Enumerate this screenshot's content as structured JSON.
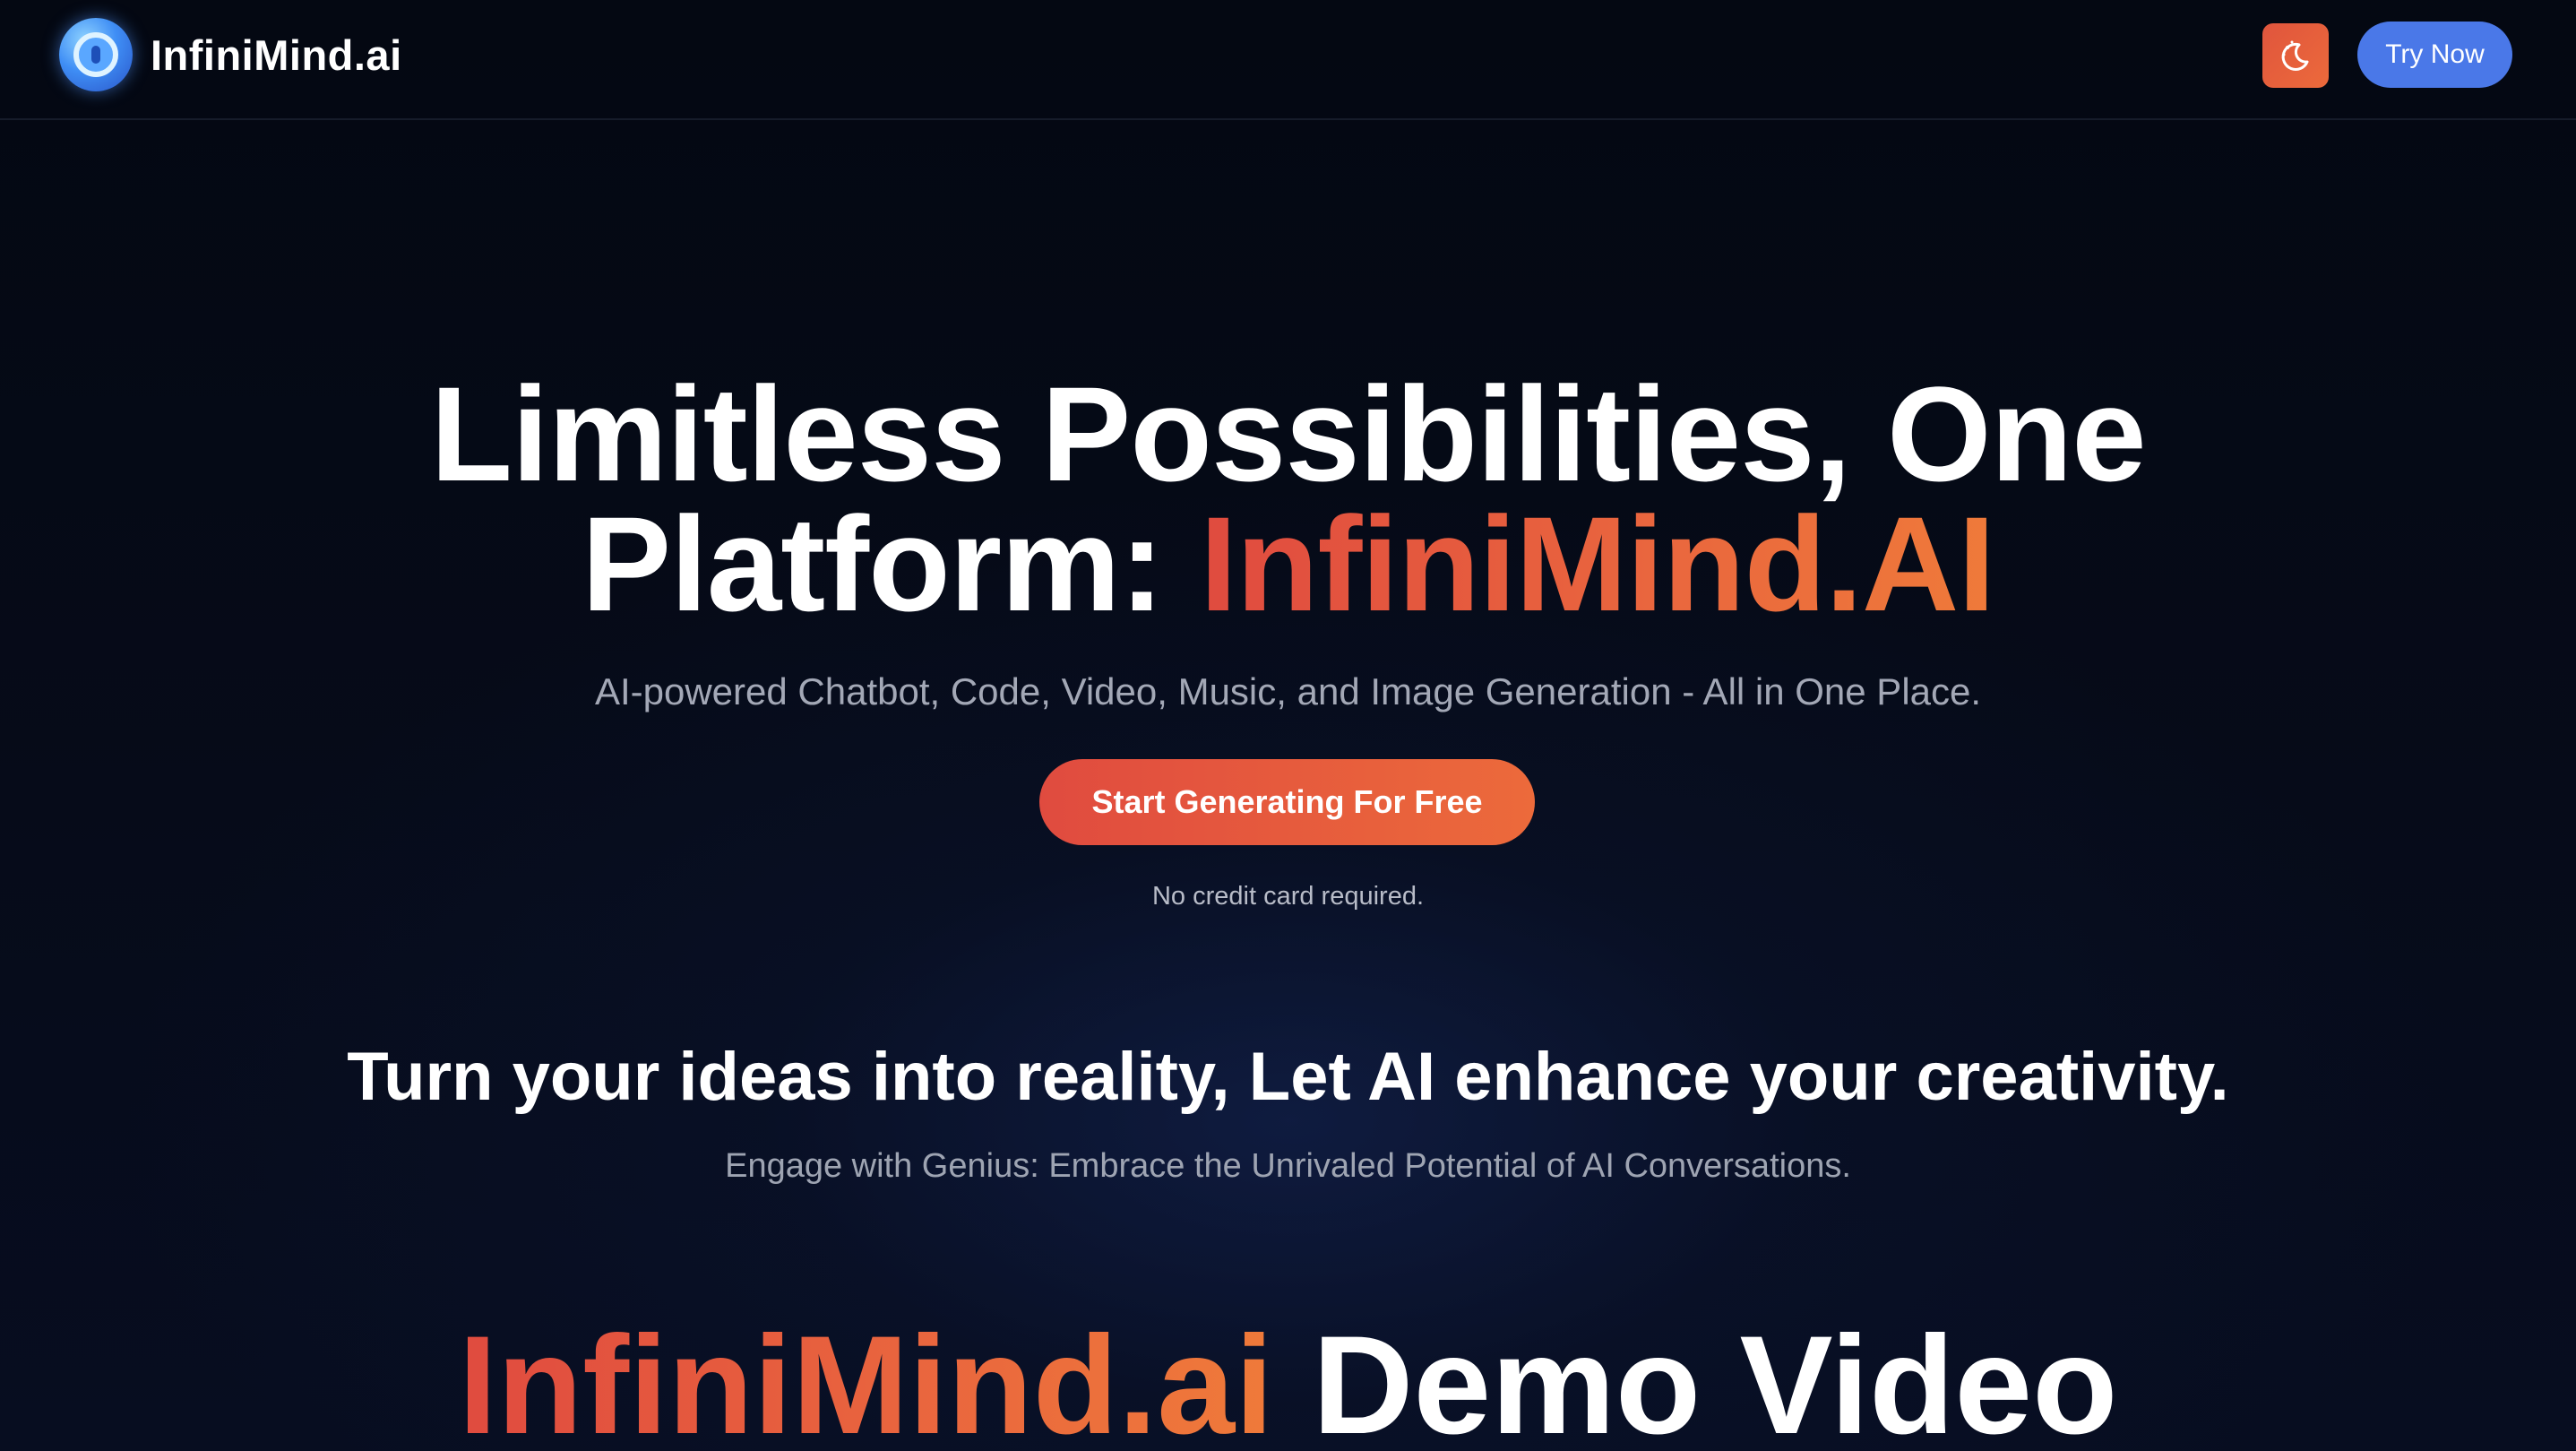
{
  "header": {
    "brand_name": "InfiniMind.ai",
    "try_now_label": "Try Now"
  },
  "hero": {
    "title_line1": "Limitless Possibilities, One",
    "title_line2_prefix": "Platform: ",
    "title_line2_highlight": "InfiniMind.AI",
    "subtitle": "AI-powered Chatbot, Code, Video, Music, and Image Generation - All in One Place.",
    "cta_label": "Start Generating For Free",
    "cta_note": "No credit card required."
  },
  "tagline": {
    "title": "Turn your ideas into reality, Let AI enhance your creativity.",
    "subtitle": "Engage with Genius: Embrace the Unrivaled Potential of AI Conversations."
  },
  "demo": {
    "title_highlight": "InfiniMind.ai",
    "title_rest": " Demo Video"
  },
  "colors": {
    "background": "#050914",
    "accent_orange": "#e9653e",
    "accent_blue": "#4a78e8"
  },
  "icons": {
    "logo": "infinimind-logo-icon",
    "theme_toggle": "moon-stars-icon"
  }
}
